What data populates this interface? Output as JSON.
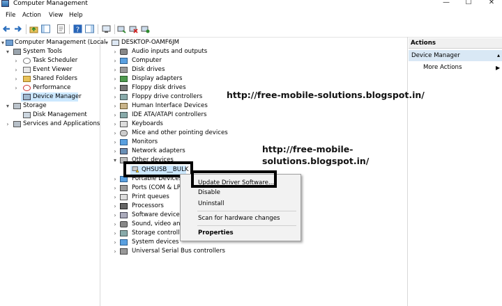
{
  "window": {
    "title": "Computer Management",
    "minimize": "—",
    "maximize": "☐",
    "close": "✕"
  },
  "menu": [
    "File",
    "Action",
    "View",
    "Help"
  ],
  "left_tree": [
    {
      "label": "Computer Management (Local",
      "icon": "computer-management-icon"
    },
    {
      "label": "System Tools",
      "icon": "tools-icon"
    },
    {
      "label": "Task Scheduler",
      "icon": "clock-icon"
    },
    {
      "label": "Event Viewer",
      "icon": "event-viewer-icon"
    },
    {
      "label": "Shared Folders",
      "icon": "shared-folder-icon"
    },
    {
      "label": "Performance",
      "icon": "performance-icon"
    },
    {
      "label": "Device Manager",
      "icon": "device-manager-icon"
    },
    {
      "label": "Storage",
      "icon": "storage-icon"
    },
    {
      "label": "Disk Management",
      "icon": "disk-management-icon"
    },
    {
      "label": "Services and Applications",
      "icon": "services-icon"
    }
  ],
  "device_tree": {
    "root": "DESKTOP-OAMF6JM",
    "items": [
      "Audio inputs and outputs",
      "Computer",
      "Disk drives",
      "Display adapters",
      "Floppy disk drives",
      "Floppy drive controllers",
      "Human Interface Devices",
      "IDE ATA/ATAPI controllers",
      "Keyboards",
      "Mice and other pointing devices",
      "Monitors",
      "Network adapters",
      "Other devices",
      "QHSUSB__BULK",
      "Portable Devices",
      "Ports (COM & LPT",
      "Print queues",
      "Processors",
      "Software devices",
      "Sound, video and",
      "Storage controller",
      "System devices",
      "Universal Serial Bus controllers"
    ]
  },
  "context_menu": [
    "Update Driver Software...",
    "Disable",
    "Uninstall",
    "Scan for hardware changes",
    "Properties"
  ],
  "actions": {
    "header": "Actions",
    "section": "Device Manager",
    "more": "More Actions"
  },
  "watermarks": {
    "one": "http://free-mobile-solutions.blogspot.in/",
    "two_line1": "http://free-mobile-",
    "two_line2": "solutions.blogspot.in/"
  }
}
